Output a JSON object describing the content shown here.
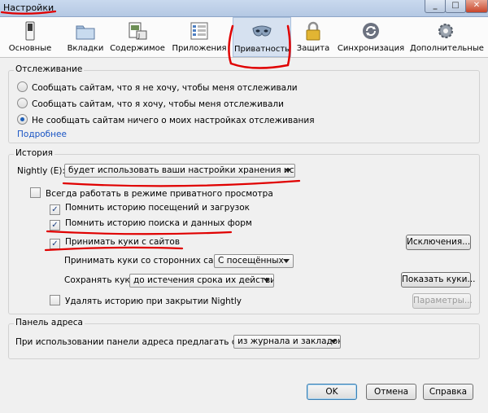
{
  "window": {
    "title": "Настройки"
  },
  "toolbar": {
    "tabs": [
      {
        "label": "Основные",
        "icon": "general-switch-icon"
      },
      {
        "label": "Вкладки",
        "icon": "tabs-folder-icon"
      },
      {
        "label": "Содержимое",
        "icon": "content-page-icon"
      },
      {
        "label": "Приложения",
        "icon": "applications-list-icon"
      },
      {
        "label": "Приватность",
        "icon": "privacy-mask-icon",
        "active": true
      },
      {
        "label": "Защита",
        "icon": "security-lock-icon"
      },
      {
        "label": "Синхронизация",
        "icon": "sync-arrows-icon"
      },
      {
        "label": "Дополнительные",
        "icon": "advanced-gear-icon"
      }
    ]
  },
  "tracking": {
    "legend": "Отслеживание",
    "options": [
      "Сообщать сайтам, что я не хочу, чтобы меня отслеживали",
      "Сообщать сайтам, что я хочу, чтобы меня отслеживали",
      "Не сообщать сайтам ничего о моих настройках отслеживания"
    ],
    "selected_index": 2,
    "more_link": "Подробнее"
  },
  "history": {
    "legend": "История",
    "mode_label": "Nightly (E):",
    "mode_value": "будет использовать ваши настройки хранения истории",
    "private_mode": {
      "label": "Всегда работать в режиме приватного просмотра",
      "checked": false
    },
    "remember_visits": {
      "label": "Помнить историю посещений и загрузок",
      "checked": true
    },
    "remember_forms": {
      "label": "Помнить историю поиска и данных форм",
      "checked": true
    },
    "accept_cookies": {
      "label": "Принимать куки с сайтов",
      "checked": true
    },
    "exceptions_button": "Исключения...",
    "third_party_label": "Принимать куки со сторонних сайтов:",
    "third_party_value": "С посещённых",
    "keep_label": "Сохранять куки:",
    "keep_value": "до истечения срока их действия",
    "show_cookies_button": "Показать куки...",
    "clear_on_close": {
      "label": "Удалять историю при закрытии Nightly",
      "checked": false
    },
    "settings_button": "Параметры..."
  },
  "address_bar": {
    "legend": "Панель адреса",
    "suggest_label": "При использовании панели адреса предлагать ссылки:",
    "suggest_value": "из журнала и закладок"
  },
  "footer": {
    "ok": "OK",
    "cancel": "Отмена",
    "help": "Справка"
  },
  "colors": {
    "annotation": "#e00000",
    "link": "#1a55c4",
    "active_tab": "#d6e1f0"
  }
}
